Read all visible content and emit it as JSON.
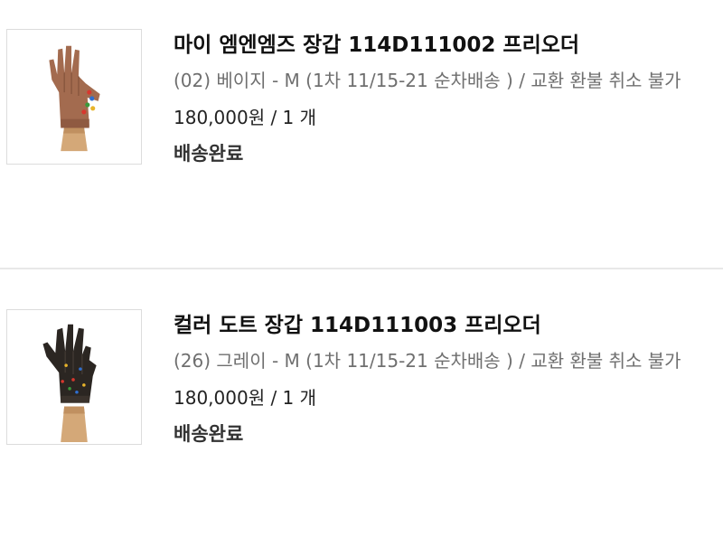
{
  "orders": [
    {
      "thumbnail_icon": "brown-leather-glove-image",
      "glove_color": "#a36b4f",
      "name": "마이 엠엔엠즈 장갑 114D111002 프리오더",
      "option": "(02) 베이지 - M (1차 11/15-21 순차배송 ) / 교환 환불 취소 불가",
      "price_qty": "180,000원 / 1 개",
      "status": "배송완료"
    },
    {
      "thumbnail_icon": "black-dotted-glove-image",
      "glove_color": "#2b2622",
      "name": "컬러 도트 장갑 114D111003 프리오더",
      "option": "(26) 그레이 - M (1차 11/15-21 순차배송 ) / 교환 환불 취소 불가",
      "price_qty": "180,000원 / 1 개",
      "status": "배송완료"
    }
  ]
}
